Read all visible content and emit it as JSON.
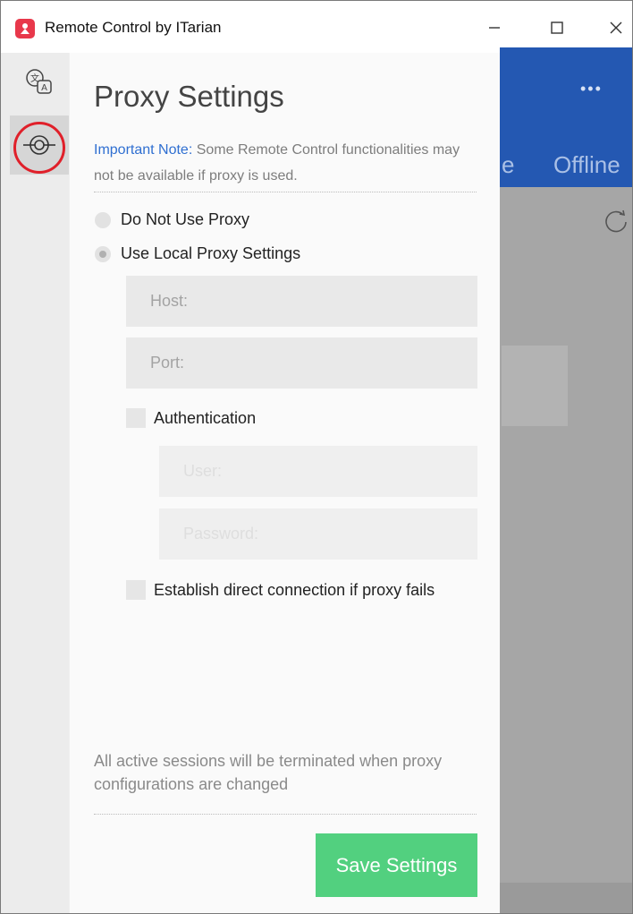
{
  "window": {
    "title": "Remote Control by ITarian"
  },
  "background_app": {
    "dots": "•••",
    "tab_partial": "e",
    "tab_offline": "Offline"
  },
  "proxy": {
    "title": "Proxy Settings",
    "note_lead": "Important Note:",
    "note_text": " Some Remote Control functionalities may not be available if proxy is used.",
    "options": [
      {
        "label": "Do Not Use Proxy",
        "checked": false
      },
      {
        "label": "Use Local Proxy Settings",
        "checked": true
      }
    ],
    "host_placeholder": "Host:",
    "port_placeholder": "Port:",
    "authentication_label": "Authentication",
    "user_placeholder": "User:",
    "password_placeholder": "Password:",
    "direct_connection_label": "Establish direct connection if proxy fails",
    "footnote": "All active sessions will be terminated when proxy configurations are changed",
    "save_label": "Save Settings"
  },
  "colors": {
    "accent_save": "#52d07f",
    "note_link": "#2f6fd1",
    "header_blue": "#2458b2",
    "highlight_ring": "#e0202a"
  },
  "icons": [
    "app-logo-icon",
    "minimize-icon",
    "maximize-icon",
    "close-icon",
    "language-icon",
    "proxy-icon",
    "refresh-icon"
  ]
}
